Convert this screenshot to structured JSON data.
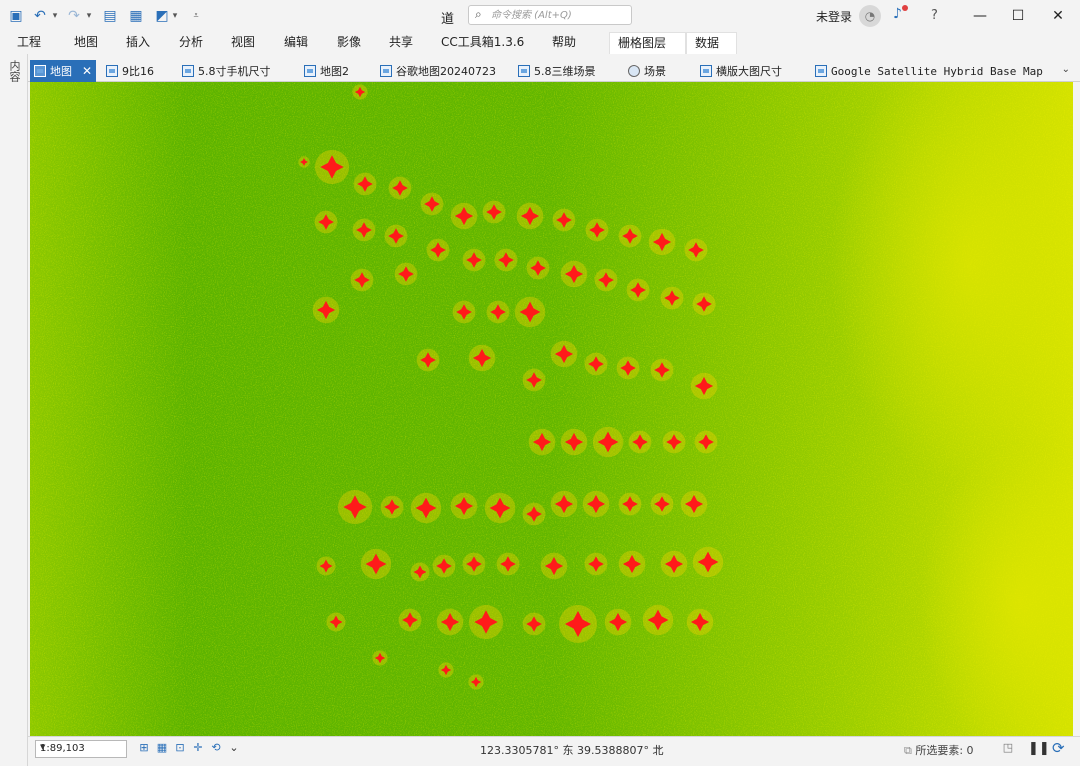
{
  "title_bar": {
    "title": "道",
    "search_placeholder": "命令搜索 (Alt+Q)",
    "login": "未登录",
    "help": "?"
  },
  "ribbon": {
    "tabs": [
      "工程",
      "地图",
      "插入",
      "分析",
      "视图",
      "编辑",
      "影像",
      "共享",
      "CC工具箱1.3.6",
      "帮助"
    ],
    "contextual_tabs": [
      "栅格图层",
      "数据"
    ]
  },
  "left_panel": {
    "label": "内容"
  },
  "doc_tabs": [
    {
      "label": "地图",
      "active": true
    },
    {
      "label": "9比16"
    },
    {
      "label": "5.8寸手机尺寸"
    },
    {
      "label": "地图2"
    },
    {
      "label": "谷歌地图20240723"
    },
    {
      "label": "5.8三维场景"
    },
    {
      "label": "场景"
    },
    {
      "label": "横版大图尺寸"
    },
    {
      "label": "Google Satellite Hybrid Base Map"
    }
  ],
  "status_bar": {
    "scale": "1:89,103",
    "coordinates": "123.3305781° 东 39.5388807° 北",
    "selected_features": "所选要素: 0"
  },
  "colors": {
    "accent": "#2a6fb8",
    "map_green": "#62b600",
    "map_yellow": "#e8ea00",
    "hotspot_red": "#ff1a1a"
  }
}
